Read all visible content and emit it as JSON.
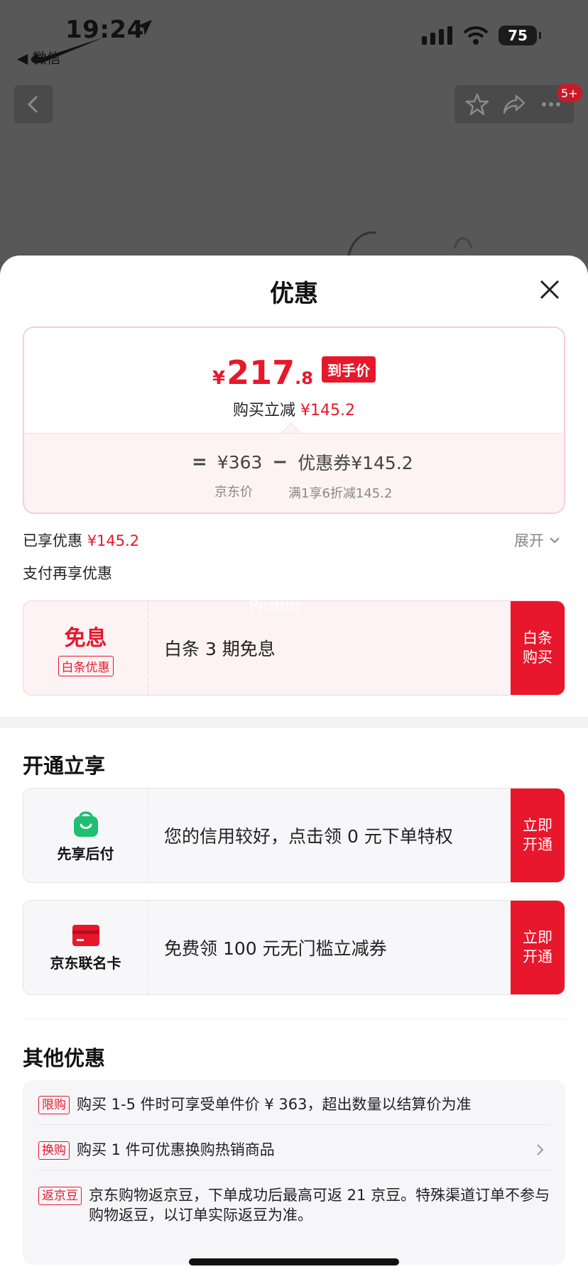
{
  "status_bar": {
    "time": "19:24",
    "back_app": "◀ 微信",
    "battery": "75"
  },
  "top_nav": {
    "badge": "5+"
  },
  "sheet": {
    "title": "优惠",
    "price_card": {
      "symbol": "¥",
      "price_int": "217",
      "price_dec": ".8",
      "tag": "到手价",
      "reduce_label": "购买立减",
      "reduce_value": "¥145.2",
      "eq": "=",
      "jd_price": "¥363",
      "minus": "−",
      "coupon": "优惠券¥145.2",
      "jd_price_label": "京东价",
      "coupon_label": "满1享6折减145.2"
    },
    "enjoyed_label": "已享优惠",
    "enjoyed_value": "¥145.2",
    "expand_label": "展开",
    "pay_more_label": "支付再享优惠",
    "baitiao": {
      "big": "免息",
      "small": "白条优惠",
      "text": "白条 3 期免息",
      "button": "白条购买",
      "watermark": "Piubiu"
    },
    "open_section_title": "开通立享",
    "open_items": [
      {
        "name": "先享后付",
        "text": "您的信用较好，点击领 0 元下单特权",
        "button": "立即开通"
      },
      {
        "name": "京东联名卡",
        "text": "免费领 100 元无门槛立减券",
        "button": "立即开通"
      }
    ],
    "other_section_title": "其他优惠",
    "other_items": [
      {
        "tag": "限购",
        "text": "购买 1-5 件时可享受单件价 ¥ 363，超出数量以结算价为准"
      },
      {
        "tag": "换购",
        "text": "购买 1 件可优惠换购热销商品"
      },
      {
        "tag": "返京豆",
        "text": "京东购物返京豆，下单成功后最高可返 21 京豆。特殊渠道订单不参与购物返豆，以订单实际返豆为准。"
      }
    ]
  },
  "colors": {
    "accent_red": "#e6182c",
    "overlay": "#585858"
  }
}
